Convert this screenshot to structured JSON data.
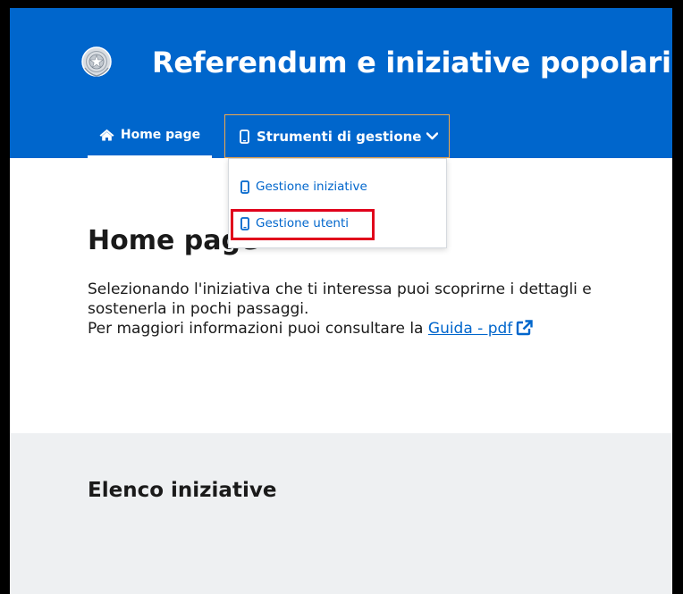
{
  "header": {
    "title": "Referendum e iniziative popolari",
    "emblem_icon": "republic-emblem-icon",
    "background_color": "#0066cc"
  },
  "nav": {
    "home": {
      "label": "Home page",
      "icon": "home-icon"
    },
    "tools": {
      "label": "Strumenti di gestione",
      "icon": "mobile-icon",
      "chevron": "chevron-down-icon"
    }
  },
  "dropdown": {
    "items": [
      {
        "label": "Gestione iniziative",
        "icon": "mobile-icon"
      },
      {
        "label": "Gestione utenti",
        "icon": "mobile-icon",
        "highlighted": true
      }
    ],
    "highlight_color": "#e0001b"
  },
  "main": {
    "title": "Home page",
    "intro_line1": "Selezionando l'iniziativa che ti interessa puoi scoprirne i dettagli e sostenerla in pochi passaggi.",
    "intro_line2_prefix": "Per maggiori informazioni puoi consultare la",
    "guide_link": "Guida - pdf",
    "external_icon": "external-link-icon"
  },
  "list": {
    "title": "Elenco iniziative"
  }
}
